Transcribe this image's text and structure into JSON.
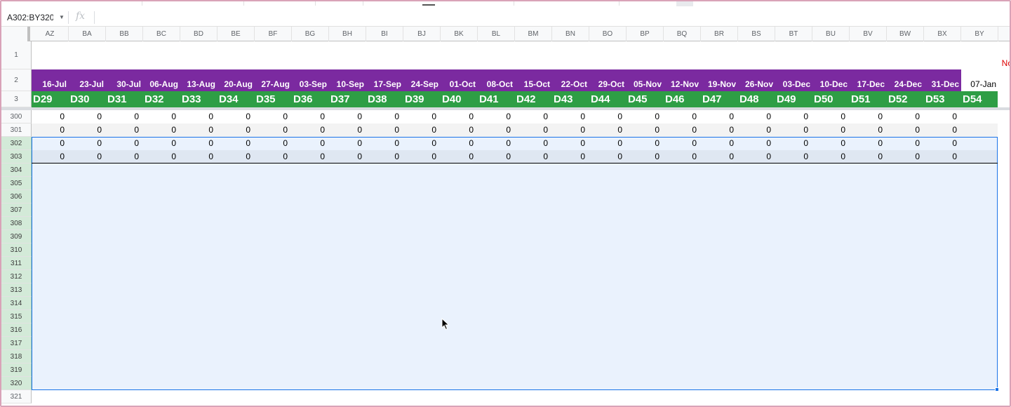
{
  "name_box": {
    "value": "A302:BY320"
  },
  "formula_bar": {
    "fx_label": "fx",
    "value": ""
  },
  "columns": [
    "AZ",
    "BA",
    "BB",
    "BC",
    "BD",
    "BE",
    "BF",
    "BG",
    "BH",
    "BI",
    "BJ",
    "BK",
    "BL",
    "BM",
    "BN",
    "BO",
    "BP",
    "BQ",
    "BR",
    "BS",
    "BT",
    "BU",
    "BV",
    "BW",
    "BX",
    "BY"
  ],
  "frozen_rows": [
    "1",
    "2",
    "3"
  ],
  "dates": [
    "16-Jul",
    "23-Jul",
    "30-Jul",
    "06-Aug",
    "13-Aug",
    "20-Aug",
    "27-Aug",
    "03-Sep",
    "10-Sep",
    "17-Sep",
    "24-Sep",
    "01-Oct",
    "08-Oct",
    "15-Oct",
    "22-Oct",
    "29-Oct",
    "05-Nov",
    "12-Nov",
    "19-Nov",
    "26-Nov",
    "03-Dec",
    "10-Dec",
    "17-Dec",
    "24-Dec",
    "31-Dec",
    "07-Jan"
  ],
  "days": [
    "D29",
    "D30",
    "D31",
    "D32",
    "D33",
    "D34",
    "D35",
    "D36",
    "D37",
    "D38",
    "D39",
    "D40",
    "D41",
    "D42",
    "D43",
    "D44",
    "D45",
    "D46",
    "D47",
    "D48",
    "D49",
    "D50",
    "D51",
    "D52",
    "D53",
    "D54"
  ],
  "row1_note": "No",
  "rows": [
    "300",
    "301",
    "302",
    "303",
    "304",
    "305",
    "306",
    "307",
    "308",
    "309",
    "310",
    "311",
    "312",
    "313",
    "314",
    "315",
    "316",
    "317",
    "318",
    "319",
    "320",
    "321"
  ],
  "data_rows": [
    {
      "row": "300",
      "values": [
        "0",
        "0",
        "0",
        "0",
        "0",
        "0",
        "0",
        "0",
        "0",
        "0",
        "0",
        "0",
        "0",
        "0",
        "0",
        "0",
        "0",
        "0",
        "0",
        "0",
        "0",
        "0",
        "0",
        "0",
        "0"
      ]
    },
    {
      "row": "301",
      "values": [
        "0",
        "0",
        "0",
        "0",
        "0",
        "0",
        "0",
        "0",
        "0",
        "0",
        "0",
        "0",
        "0",
        "0",
        "0",
        "0",
        "0",
        "0",
        "0",
        "0",
        "0",
        "0",
        "0",
        "0",
        "0"
      ]
    },
    {
      "row": "302",
      "values": [
        "0",
        "0",
        "0",
        "0",
        "0",
        "0",
        "0",
        "0",
        "0",
        "0",
        "0",
        "0",
        "0",
        "0",
        "0",
        "0",
        "0",
        "0",
        "0",
        "0",
        "0",
        "0",
        "0",
        "0",
        "0"
      ]
    },
    {
      "row": "303",
      "values": [
        "0",
        "0",
        "0",
        "0",
        "0",
        "0",
        "0",
        "0",
        "0",
        "0",
        "0",
        "0",
        "0",
        "0",
        "0",
        "0",
        "0",
        "0",
        "0",
        "0",
        "0",
        "0",
        "0",
        "0",
        "0"
      ]
    }
  ],
  "colors": {
    "date_header": "#7b2aa0",
    "day_header": "#2e9e45",
    "selection": "#1a73e8",
    "note": "#dd0000"
  }
}
